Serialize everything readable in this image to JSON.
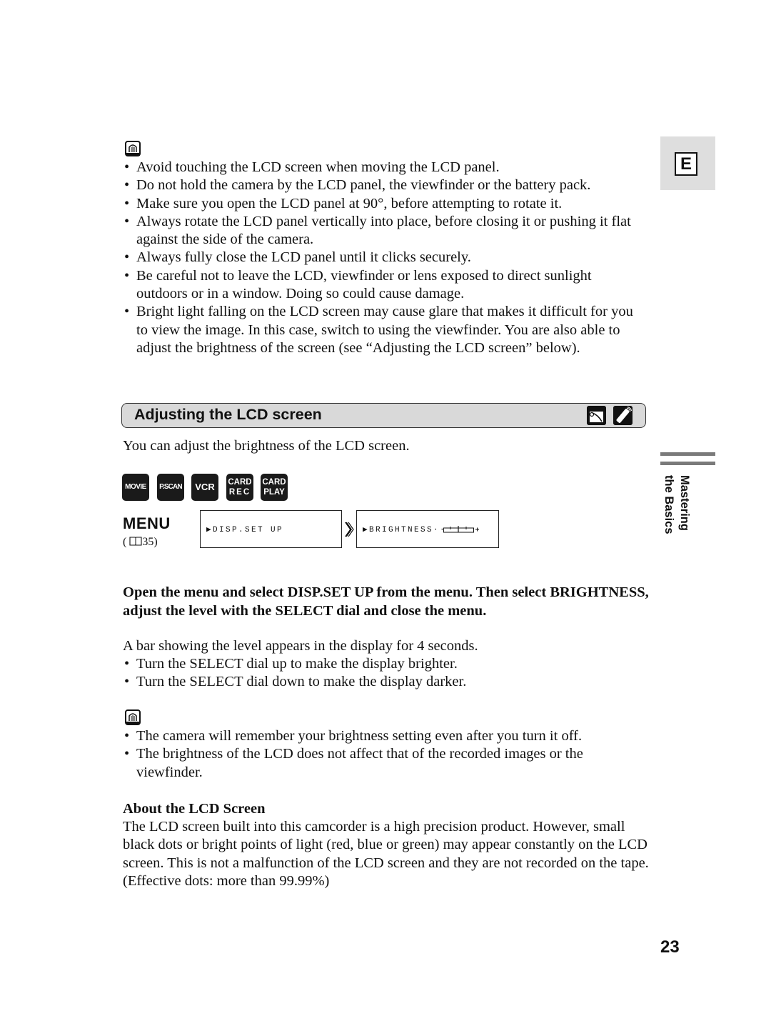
{
  "language_tab": "E",
  "side_tab": {
    "line1": "Mastering",
    "line2": "the Basics"
  },
  "page_number": "23",
  "notes_top": {
    "icon": "note-icon",
    "items": [
      "Avoid touching the LCD screen when moving the LCD panel.",
      "Do not hold the camera by the LCD panel, the viewfinder or the battery pack.",
      "Make sure you open the LCD panel at 90°, before attempting to rotate it.",
      "Always rotate the LCD panel vertically into place, before closing it or pushing it flat against the side of the camera.",
      "Always fully close the LCD panel until it clicks securely.",
      "Be careful not to leave the LCD, viewfinder or lens exposed to direct sunlight outdoors or in a window. Doing so could cause damage.",
      "Bright light falling on the LCD screen may cause glare that makes it difficult for you to view the image. In this case, switch to using the viewfinder. You are also able to adjust the brightness of the screen (see “Adjusting the LCD screen” below)."
    ]
  },
  "section": {
    "title": "Adjusting the LCD screen",
    "icons": [
      "lcd-panel-icon",
      "remote-control-icon"
    ],
    "intro": "You can adjust the brightness of the LCD screen.",
    "modes": [
      {
        "line1": "MOVIE",
        "line2": ""
      },
      {
        "line1": "P.SCAN",
        "line2": ""
      },
      {
        "line1": "VCR",
        "line2": ""
      },
      {
        "line1": "CARD",
        "line2": "REC"
      },
      {
        "line1": "CARD",
        "line2": "PLAY"
      }
    ],
    "menu_label": "MENU",
    "menu_ref": "( 🕮 35)",
    "menu_ref_page": "35",
    "screens": [
      "▶DISP.SET UP",
      "▶BRIGHTNESS··−"
    ],
    "instruction": "Open the menu and select DISP.SET UP from the menu. Then select BRIGHTNESS, adjust the level with the SELECT dial and close the menu.",
    "level_info": "A bar showing the level appears in the display for 4 seconds.",
    "bullets": [
      "Turn the SELECT dial up to make the display brighter.",
      "Turn the SELECT dial down to make the display darker."
    ]
  },
  "notes_bottom": {
    "items": [
      "The camera will remember your brightness setting even after you turn it off.",
      "The brightness of the LCD does not affect that of the recorded images or the viewfinder."
    ]
  },
  "about": {
    "heading": "About the LCD Screen",
    "body": "The LCD screen built into this camcorder is a high precision product. However, small black dots or bright points of light (red, blue or green) may appear constantly on the LCD screen. This is not a malfunction of the LCD screen and they are not recorded on the tape. (Effective dots: more than 99.99%)"
  }
}
